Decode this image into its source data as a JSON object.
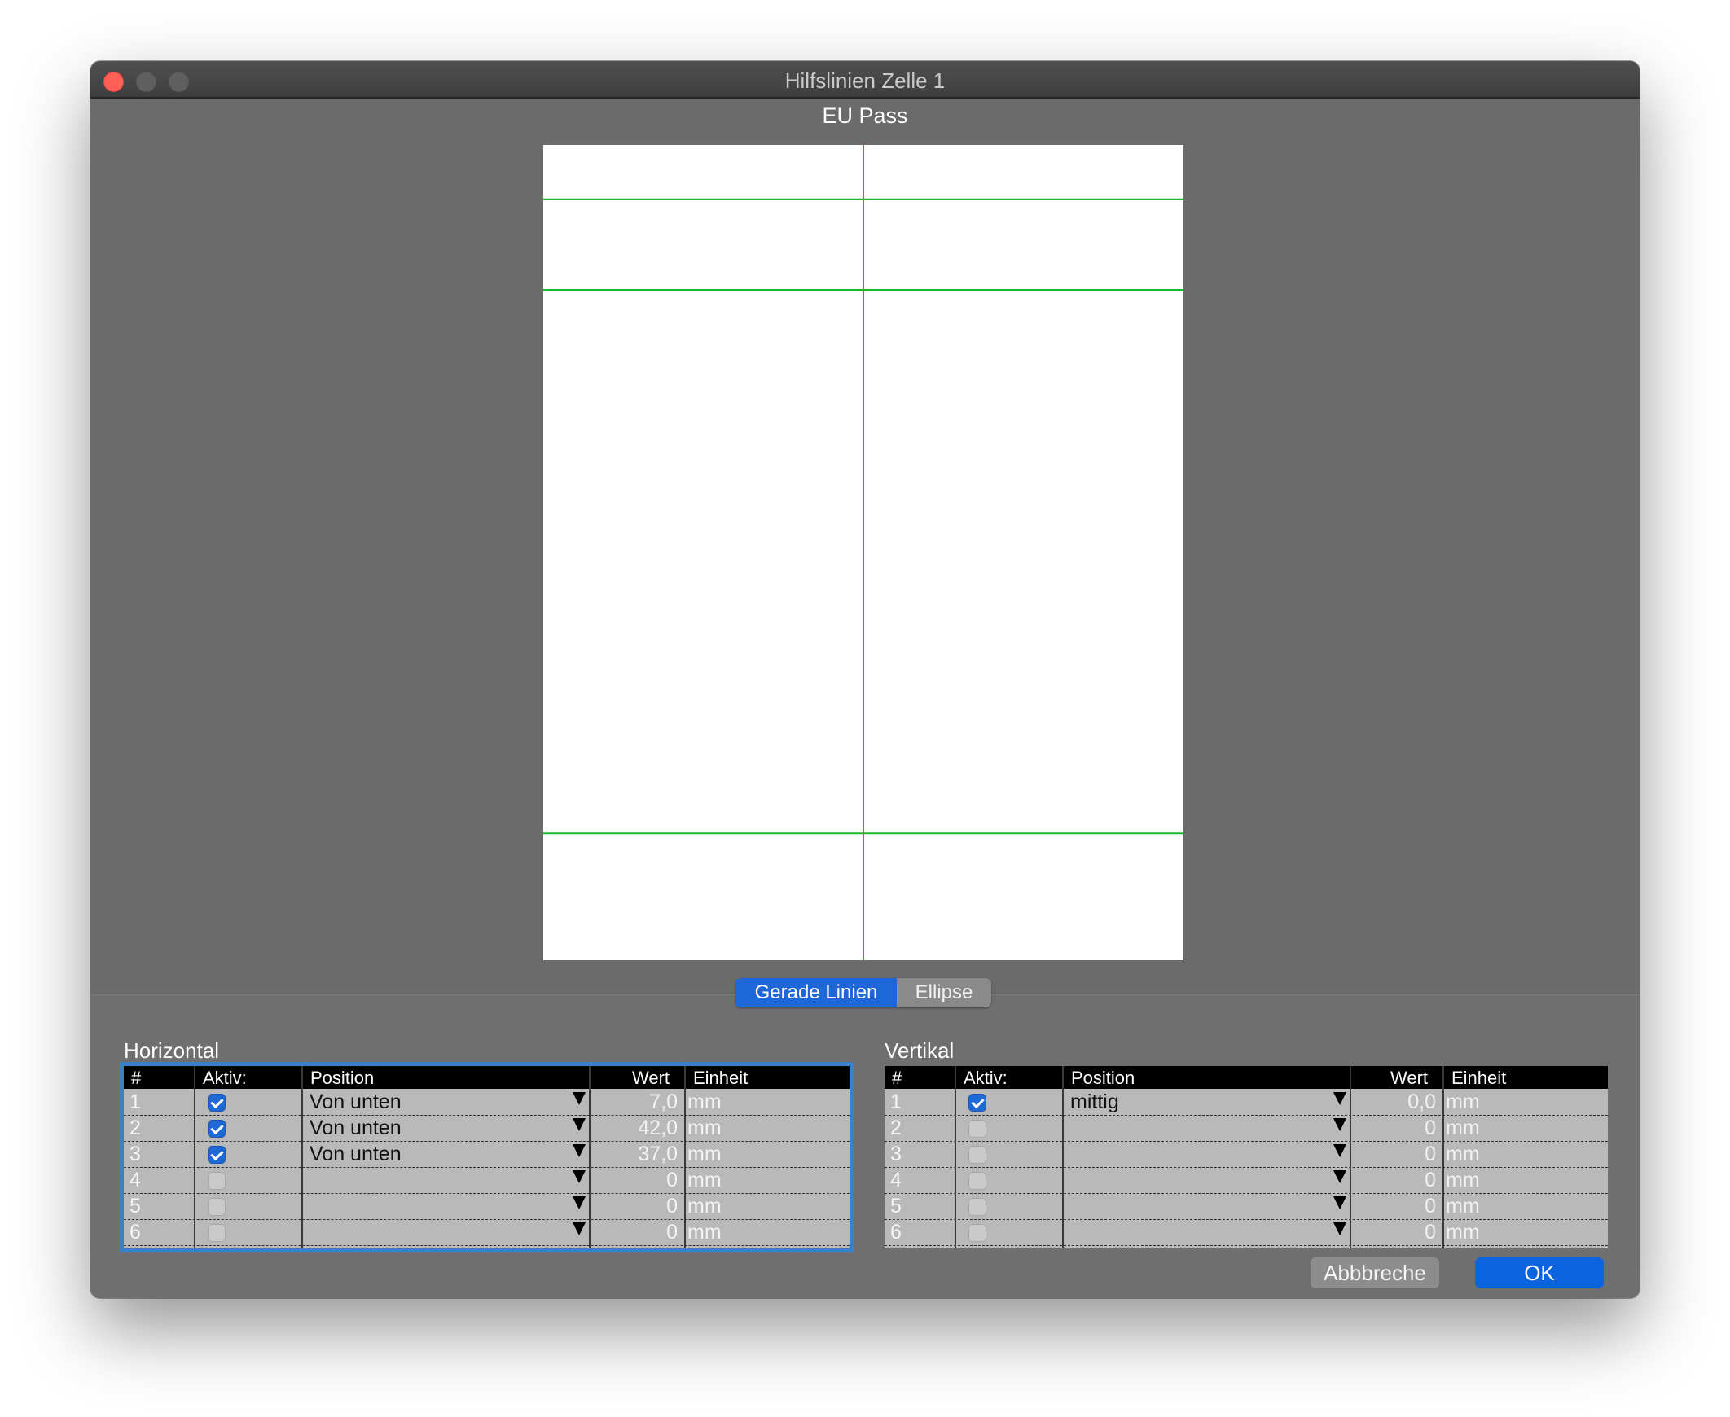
{
  "window": {
    "title": "Hilfslinien  Zelle 1",
    "preset_name": "EU Pass"
  },
  "preview": {
    "guide_color": "#17b92a",
    "vertical_guides_mm_from_center": [
      0.0
    ],
    "horizontal_guides_mm_from_bottom": [
      7.0,
      42.0,
      37.0
    ]
  },
  "tabs": [
    {
      "label": "Gerade Linien",
      "selected": true
    },
    {
      "label": "Ellipse",
      "selected": false
    }
  ],
  "horizontal": {
    "label": "Horizontal",
    "columns": [
      "#",
      "Aktiv:",
      "Position",
      "Wert",
      "Einheit"
    ],
    "rows": [
      {
        "n": "1",
        "active": true,
        "position": "Von unten",
        "value": "7,0",
        "unit": "mm"
      },
      {
        "n": "2",
        "active": true,
        "position": "Von unten",
        "value": "42,0",
        "unit": "mm"
      },
      {
        "n": "3",
        "active": true,
        "position": "Von unten",
        "value": "37,0",
        "unit": "mm"
      },
      {
        "n": "4",
        "active": false,
        "position": "",
        "value": "0",
        "unit": "mm"
      },
      {
        "n": "5",
        "active": false,
        "position": "",
        "value": "0",
        "unit": "mm"
      },
      {
        "n": "6",
        "active": false,
        "position": "",
        "value": "0",
        "unit": "mm"
      }
    ]
  },
  "vertical": {
    "label": "Vertikal",
    "columns": [
      "#",
      "Aktiv:",
      "Position",
      "Wert",
      "Einheit"
    ],
    "rows": [
      {
        "n": "1",
        "active": true,
        "position": "mittig",
        "value": "0,0",
        "unit": "mm"
      },
      {
        "n": "2",
        "active": false,
        "position": "",
        "value": "0",
        "unit": "mm"
      },
      {
        "n": "3",
        "active": false,
        "position": "",
        "value": "0",
        "unit": "mm"
      },
      {
        "n": "4",
        "active": false,
        "position": "",
        "value": "0",
        "unit": "mm"
      },
      {
        "n": "5",
        "active": false,
        "position": "",
        "value": "0",
        "unit": "mm"
      },
      {
        "n": "6",
        "active": false,
        "position": "",
        "value": "0",
        "unit": "mm"
      }
    ]
  },
  "buttons": {
    "cancel": "Abbbreche",
    "ok": "OK"
  },
  "colors": {
    "accent": "#1e67d8",
    "window_bg": "#6b6b6b"
  }
}
